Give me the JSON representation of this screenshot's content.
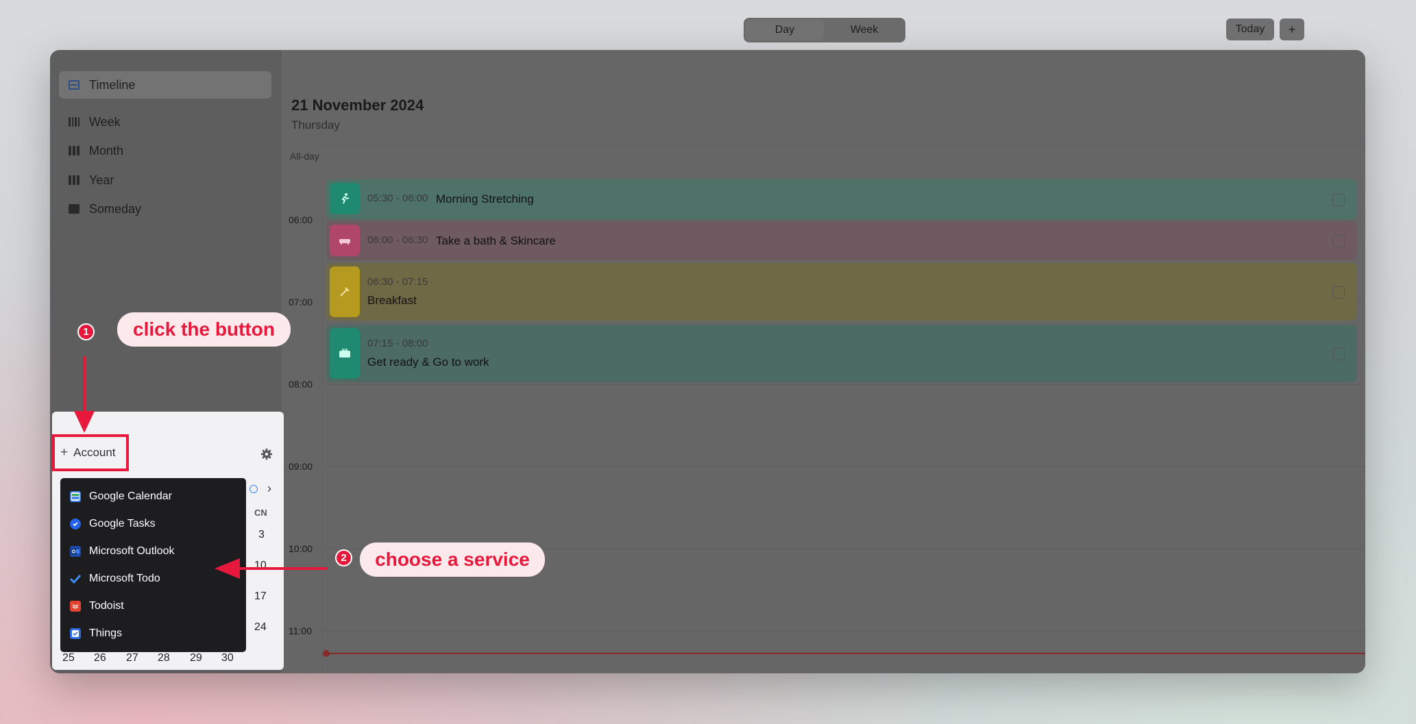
{
  "sidebar": {
    "items": [
      {
        "label": "Timeline",
        "icon": "timeline-icon"
      },
      {
        "label": "Week",
        "icon": "week-icon"
      },
      {
        "label": "Month",
        "icon": "month-icon"
      },
      {
        "label": "Year",
        "icon": "year-icon"
      },
      {
        "label": "Someday",
        "icon": "someday-icon"
      }
    ]
  },
  "header": {
    "view_day": "Day",
    "view_week": "Week",
    "today_label": "Today",
    "add_label": "+",
    "date_title": "21 November 2024",
    "weekday": "Thursday",
    "allday_label": "All-day"
  },
  "timeline": {
    "hours": [
      "06:00",
      "07:00",
      "08:00",
      "09:00",
      "10:00",
      "11:00"
    ],
    "events": [
      {
        "time": "05:30 - 06:00",
        "title": "Morning Stretching",
        "icon": "running-icon",
        "color": "#4e7268",
        "accent": "#1f8a70"
      },
      {
        "time": "06:00 - 06:30",
        "title": "Take a bath & Skincare",
        "icon": "bathtub-icon",
        "color": "#6f5a62",
        "accent": "#b0476a"
      },
      {
        "time": "06:30 - 07:15",
        "title": "Breakfast",
        "icon": "cutlery-icon",
        "color": "#706946",
        "accent": "#b69a1f"
      },
      {
        "time": "07:15 - 08:00",
        "title": "Get ready & Go to work",
        "icon": "briefcase-icon",
        "color": "#4c6b63",
        "accent": "#1f8a70"
      }
    ]
  },
  "account": {
    "add_label": "Account",
    "services": [
      {
        "label": "Google Calendar",
        "icon": "google-calendar-icon"
      },
      {
        "label": "Google Tasks",
        "icon": "google-tasks-icon"
      },
      {
        "label": "Microsoft Outlook",
        "icon": "microsoft-outlook-icon"
      },
      {
        "label": "Microsoft Todo",
        "icon": "microsoft-todo-icon"
      },
      {
        "label": "Todoist",
        "icon": "todoist-icon"
      },
      {
        "label": "Things",
        "icon": "things-icon"
      }
    ]
  },
  "mini_calendar": {
    "weekday_header": "CN",
    "right_column": [
      "3",
      "10",
      "17",
      "24"
    ],
    "last_row": [
      "25",
      "26",
      "27",
      "28",
      "29",
      "30"
    ]
  },
  "annotations": {
    "step1_number": "1",
    "step1_text": "click the button",
    "step2_number": "2",
    "step2_text": "choose a service",
    "accent_color": "#e8183c"
  }
}
